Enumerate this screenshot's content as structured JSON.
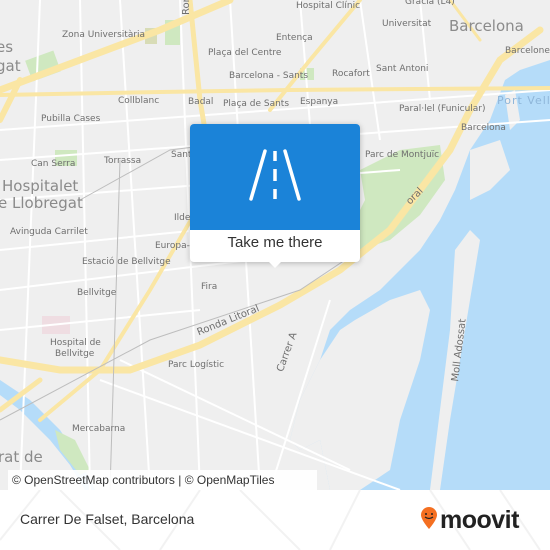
{
  "map": {
    "labels": {
      "zona_universitaria": "Zona Universitària",
      "hospital_clinic": "Hospital Clínic",
      "gracia": "Gràcia (L4)",
      "universitat": "Universitat",
      "barcelona_city": "Barcelona",
      "barceloneta": "Barceloneta",
      "placa_del_centre": "Plaça del Centre",
      "entenca": "Entença",
      "barcelona_sants": "Barcelona - Sants",
      "rocafort": "Rocafort",
      "sant_antoni": "Sant Antoni",
      "collblanc": "Collblanc",
      "badal": "Badal",
      "placa_de_sants": "Plaça de Sants",
      "espanya": "Espanya",
      "parallel": "Paral·lel (Funicular)",
      "port_vell": "Port Vell",
      "pubilla_cases": "Pubilla Cases",
      "barcelona_station": "Barcelona",
      "can_serra": "Can Serra",
      "torrassa": "Torrassa",
      "parc_montjuic": "Parc de Montjuïc",
      "hospitalet_1": "Hospitalet",
      "hospitalet_2": "e Llobregat",
      "es": "es",
      "gat": "gat",
      "avinguda_carrilet": "Avinguda Carrilet",
      "estacio_bellvitge": "Estació de Bellvitge",
      "bellvitge": "Bellvitge",
      "fira": "Fira",
      "ronda_litoral": "Ronda Litoral",
      "hospital_bellvitge_1": "Hospital de",
      "hospital_bellvitge_2": "Bellvitge",
      "parc_logistic": "Parc Logístic",
      "carrer_a": "Carrer A",
      "moll_adossat": "Moll Adossat",
      "mercabarna": "Mercabarna",
      "rat_de": "rat de",
      "ronda_top": "Ron",
      "ide": "Ilde",
      "europa": "Europa-F",
      "sant": "Sant",
      "ronda_litoral_2": "oral"
    },
    "colors": {
      "land": "#efefef",
      "water": "#b5dcf9",
      "park": "#cfe8c0",
      "highway": "#fae6a4",
      "road": "#ffffff"
    }
  },
  "popup": {
    "icon": "road-icon",
    "action_label": "Take me there",
    "header_color": "#1b83d8"
  },
  "attribution": "© OpenStreetMap contributors | © OpenMapTiles",
  "footer": {
    "place_name": "Carrer De Falset, Barcelona",
    "brand_name": "moovit",
    "brand_color": "#f46f21"
  }
}
